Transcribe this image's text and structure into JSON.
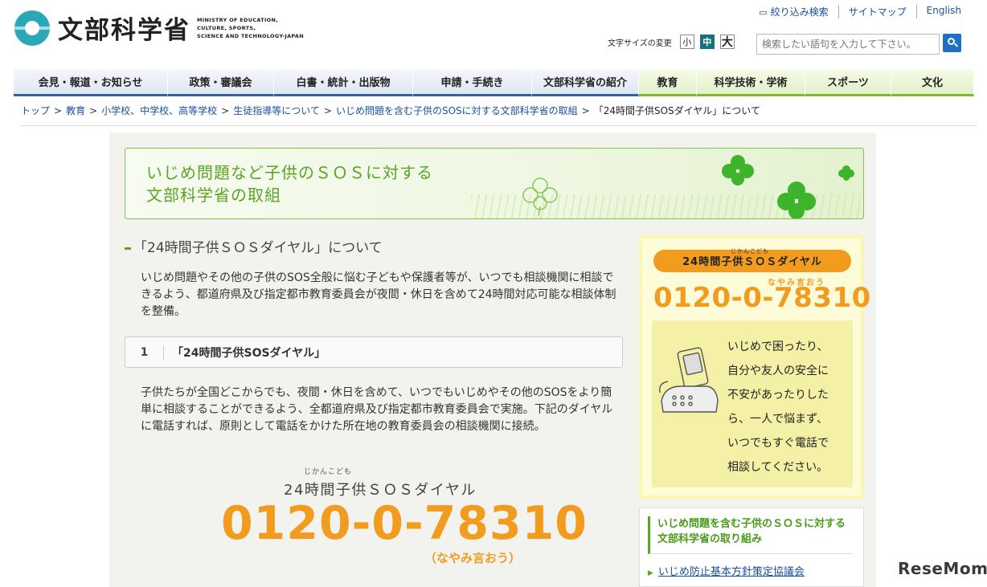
{
  "header": {
    "logo_jp": "文部科学省",
    "logo_en_lines": [
      "MINISTRY OF EDUCATION,",
      "CULTURE, SPORTS,",
      "SCIENCE AND TECHNOLOGY-JAPAN"
    ],
    "top_links": [
      "絞り込み検索",
      "サイトマップ",
      "English"
    ],
    "font_size_label": "文字サイズの変更",
    "font_sizes": [
      "小",
      "中",
      "大"
    ],
    "search_placeholder": "検索したい語句を入力して下さい。"
  },
  "nav": {
    "items": [
      {
        "label": "会見・報道・お知らせ",
        "color": "blue"
      },
      {
        "label": "政策・審議会",
        "color": "blue"
      },
      {
        "label": "白書・統計・出版物",
        "color": "blue"
      },
      {
        "label": "申請・手続き",
        "color": "blue"
      },
      {
        "label": "文部科学省の紹介",
        "color": "blue"
      },
      {
        "label": "教育",
        "color": "green"
      },
      {
        "label": "科学技術・学術",
        "color": "green"
      },
      {
        "label": "スポーツ",
        "color": "green"
      },
      {
        "label": "文化",
        "color": "green"
      }
    ]
  },
  "breadcrumb": {
    "links": [
      "トップ",
      "教育",
      "小学校、中学校、高等学校",
      "生徒指導等について",
      "いじめ問題を含む子供のSOSに対する文部科学省の取組"
    ],
    "current": "「24時間子供SOSダイヤル」について"
  },
  "banner": {
    "title_line1": "いじめ問題など子供のＳＯＳに対する",
    "title_line2": "文部科学省の取組"
  },
  "main": {
    "heading": "「24時間子供ＳＯＳダイヤル」について",
    "intro": "いじめ問題やその他の子供のSOS全般に悩む子どもや保護者等が、いつでも相談機関に相談できるよう、都道府県及び指定都市教育委員会が夜間・休日を含めて24時間対応可能な相談体制を整備。",
    "section1_num": "1",
    "section1_title": "「24時間子供SOSダイヤル」",
    "section1_body": "子供たちが全国どこからでも、夜間・休日を含めて、いつでもいじめやその他のSOSをより簡単に相談することができるよう、全都道府県及び指定都市教育委員会で実施。下記のダイヤルに電話すれば、原則として電話をかけた所在地の教育委員会の相談機関に接続。",
    "dial_ruby": "じかんこども",
    "dial_name": "24時間子供ＳＯＳダイヤル",
    "dial_number": "0120-0-78310",
    "dial_yomi": "（なやみ言おう）"
  },
  "side": {
    "pill_ruby": "じかんこども",
    "pill_label": "24時間子供ＳＯＳダイヤル",
    "yomi": "なやみ言おう",
    "number": "0120-0-78310",
    "message_lines": [
      "いじめで困ったり、",
      "自分や友人の安全に",
      "不安があったりした",
      "ら、一人で悩まず、",
      "いつでもすぐ電話で",
      "相談してください。"
    ],
    "related_title": "いじめ問題を含む子供のＳＯＳに対する文部科学省の取り組み",
    "related_link": "いじめ防止基本方針策定協議会"
  },
  "watermark": "ReseMom",
  "colors": {
    "accent_orange": "#f29c1f",
    "accent_green": "#5aa426",
    "nav_blue": "#3a5f9f",
    "nav_green": "#7cba2e",
    "link_blue": "#1a4fa0"
  }
}
